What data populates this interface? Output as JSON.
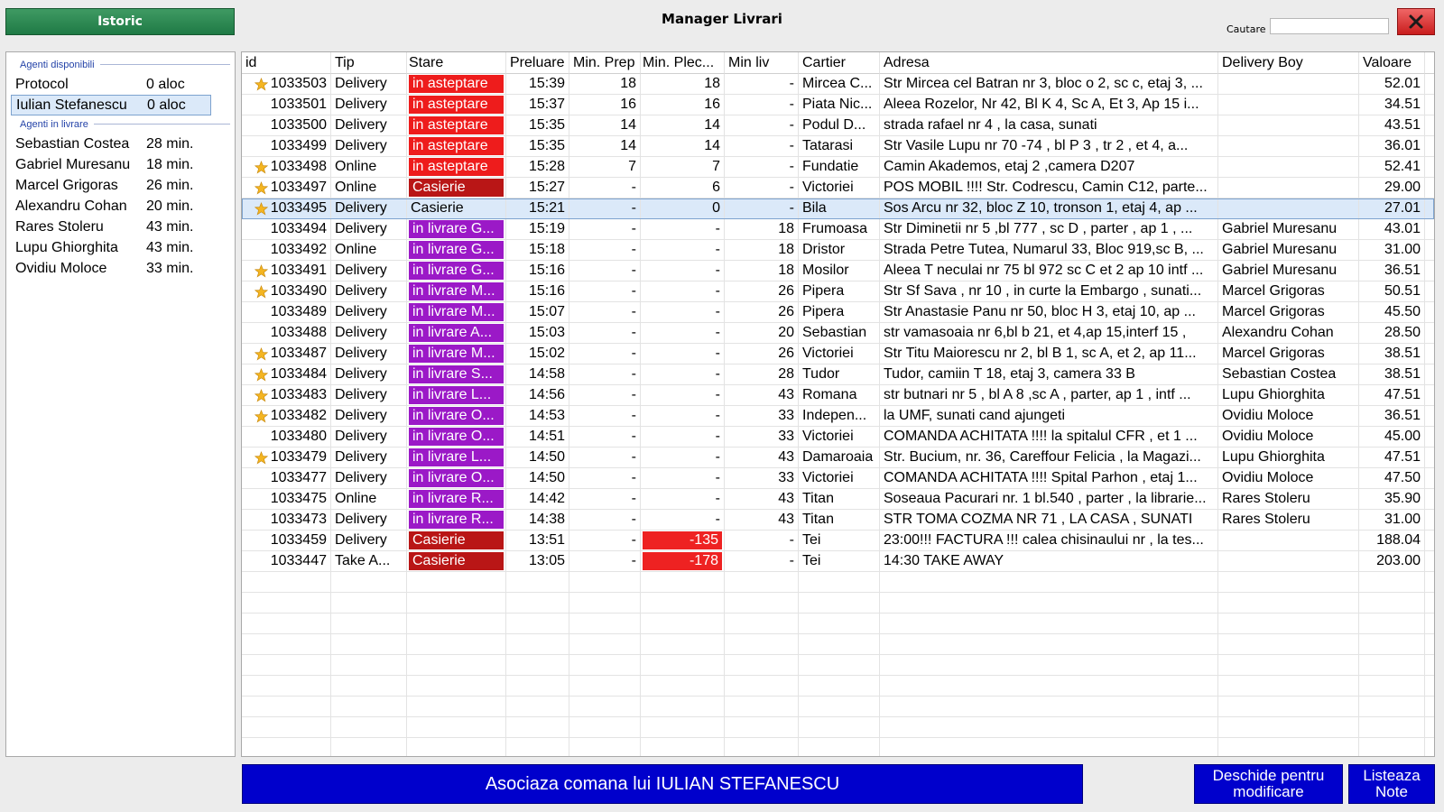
{
  "header": {
    "history_label": "Istoric",
    "title": "Manager Livrari",
    "search_label": "Cautare",
    "search_value": "",
    "close_label": "X"
  },
  "agents": {
    "available_label": "Agenti disponibili",
    "available": [
      {
        "name": "Protocol",
        "status": "0 aloc"
      },
      {
        "name": "Iulian Stefanescu",
        "status": "0 aloc",
        "selected": true
      }
    ],
    "delivering_label": "Agenti in livrare",
    "delivering": [
      {
        "name": "Sebastian Costea",
        "status": "28 min."
      },
      {
        "name": "Gabriel Muresanu",
        "status": "18 min."
      },
      {
        "name": "Marcel Grigoras",
        "status": "26 min."
      },
      {
        "name": "Alexandru Cohan",
        "status": "20 min."
      },
      {
        "name": "Rares Stoleru",
        "status": "43 min."
      },
      {
        "name": "Lupu Ghiorghita",
        "status": "43 min."
      },
      {
        "name": "Ovidiu Moloce",
        "status": "33 min."
      }
    ]
  },
  "colors": {
    "waiting": "#ee1c1c",
    "cashier": "#b91616",
    "delivering": "#9b19c7",
    "negative": "#ee2222",
    "button_blue": "#0000cc"
  },
  "table": {
    "columns": [
      "id",
      "Tip",
      "Stare",
      "Preluare",
      "Min. Prep",
      "Min. Plec...",
      "Min liv",
      "Cartier",
      "Adresa",
      "Delivery Boy",
      "Valoare"
    ],
    "rows": [
      {
        "star": true,
        "id": "1033503",
        "tip": "Delivery",
        "stare": "in asteptare",
        "kind": "waiting",
        "preluare": "15:39",
        "prep": "18",
        "plec": "18",
        "liv": "-",
        "cartier": "Mircea C...",
        "adresa": "Str Mircea cel Batran nr 3, bloc o 2, sc c, etaj 3, ...",
        "boy": "",
        "valoare": "52.01"
      },
      {
        "star": false,
        "id": "1033501",
        "tip": "Delivery",
        "stare": "in asteptare",
        "kind": "waiting",
        "preluare": "15:37",
        "prep": "16",
        "plec": "16",
        "liv": "-",
        "cartier": "Piata Nic...",
        "adresa": "Aleea Rozelor, Nr 42, Bl K 4, Sc A, Et 3, Ap 15 i...",
        "boy": "",
        "valoare": "34.51"
      },
      {
        "star": false,
        "id": "1033500",
        "tip": "Delivery",
        "stare": "in asteptare",
        "kind": "waiting",
        "preluare": "15:35",
        "prep": "14",
        "plec": "14",
        "liv": "-",
        "cartier": "Podul D...",
        "adresa": "strada rafael nr  4 , la casa, sunati",
        "boy": "",
        "valoare": "43.51"
      },
      {
        "star": false,
        "id": "1033499",
        "tip": "Delivery",
        "stare": "in asteptare",
        "kind": "waiting",
        "preluare": "15:35",
        "prep": "14",
        "plec": "14",
        "liv": "-",
        "cartier": "Tatarasi",
        "adresa": " Str Vasile Lupu nr 70 -74 , bl P 3 , tr 2 , et 4, a...",
        "boy": "",
        "valoare": "36.01"
      },
      {
        "star": true,
        "id": "1033498",
        "tip": "Online",
        "stare": "in asteptare",
        "kind": "waiting",
        "preluare": "15:28",
        "prep": "7",
        "plec": "7",
        "liv": "-",
        "cartier": "Fundatie",
        "adresa": "Camin Akademos, etaj 2 ,camera D207",
        "boy": "",
        "valoare": "52.41"
      },
      {
        "star": true,
        "id": "1033497",
        "tip": "Online",
        "stare": "Casierie",
        "kind": "cashier",
        "preluare": "15:27",
        "prep": "-",
        "plec": "6",
        "liv": "-",
        "cartier": "Victoriei",
        "adresa": "POS MOBIL !!!!  Str. Codrescu, Camin C12, parte...",
        "boy": "",
        "valoare": "29.00"
      },
      {
        "star": true,
        "id": "1033495",
        "tip": "Delivery",
        "stare": "Casierie",
        "kind": "plain",
        "selected": true,
        "preluare": "15:21",
        "prep": "-",
        "plec": "0",
        "liv": "-",
        "cartier": "Bila",
        "adresa": "Sos Arcu nr 32, bloc Z 10, tronson  1, etaj 4, ap ...",
        "boy": "",
        "valoare": "27.01"
      },
      {
        "star": false,
        "id": "1033494",
        "tip": "Delivery",
        "stare": "in livrare G...",
        "kind": "delivering",
        "preluare": "15:19",
        "prep": "-",
        "plec": "-",
        "liv": "18",
        "cartier": "Frumoasa",
        "adresa": "Str Diminetii nr 5 ,bl 777 , sc D ,  parter , ap 1 ,  ...",
        "boy": "Gabriel Muresanu",
        "valoare": "43.01"
      },
      {
        "star": false,
        "id": "1033492",
        "tip": "Online",
        "stare": "in livrare G...",
        "kind": "delivering",
        "preluare": "15:18",
        "prep": "-",
        "plec": "-",
        "liv": "18",
        "cartier": "Dristor",
        "adresa": "Strada Petre Tutea, Numarul 33, Bloc 919,sc B,  ...",
        "boy": "Gabriel Muresanu",
        "valoare": "31.00"
      },
      {
        "star": true,
        "id": "1033491",
        "tip": "Delivery",
        "stare": "in livrare G...",
        "kind": "delivering",
        "preluare": "15:16",
        "prep": "-",
        "plec": "-",
        "liv": "18",
        "cartier": "Mosilor",
        "adresa": "Aleea T neculai nr 75 bl 972 sc C et 2 ap 10 intf ...",
        "boy": "Gabriel Muresanu",
        "valoare": "36.51"
      },
      {
        "star": true,
        "id": "1033490",
        "tip": "Delivery",
        "stare": "in livrare M...",
        "kind": "delivering",
        "preluare": "15:16",
        "prep": "-",
        "plec": "-",
        "liv": "26",
        "cartier": "Pipera",
        "adresa": "Str Sf Sava , nr 10 , in curte la Embargo  , sunati...",
        "boy": "Marcel Grigoras",
        "valoare": "50.51"
      },
      {
        "star": false,
        "id": "1033489",
        "tip": "Delivery",
        "stare": "in livrare M...",
        "kind": "delivering",
        "preluare": "15:07",
        "prep": "-",
        "plec": "-",
        "liv": "26",
        "cartier": "Pipera",
        "adresa": "Str Anastasie   Panu nr 50, bloc H 3, etaj 10, ap ...",
        "boy": "Marcel Grigoras",
        "valoare": "45.50"
      },
      {
        "star": false,
        "id": "1033488",
        "tip": "Delivery",
        "stare": "in livrare A...",
        "kind": "delivering",
        "preluare": "15:03",
        "prep": "-",
        "plec": "-",
        "liv": "20",
        "cartier": "Sebastian",
        "adresa": "str vamasoaia nr 6,bl b 21, et 4,ap 15,interf 15 ,",
        "boy": "Alexandru Cohan",
        "valoare": "28.50"
      },
      {
        "star": true,
        "id": "1033487",
        "tip": "Delivery",
        "stare": "in livrare M...",
        "kind": "delivering",
        "preluare": "15:02",
        "prep": "-",
        "plec": "-",
        "liv": "26",
        "cartier": "Victoriei",
        "adresa": "Str Titu  Maiorescu nr 2, bl B 1, sc A, et 2, ap 11...",
        "boy": "Marcel Grigoras",
        "valoare": "38.51"
      },
      {
        "star": true,
        "id": "1033484",
        "tip": "Delivery",
        "stare": "in livrare S...",
        "kind": "delivering",
        "preluare": "14:58",
        "prep": "-",
        "plec": "-",
        "liv": "28",
        "cartier": "Tudor",
        "adresa": "Tudor, camiin T 18, etaj 3, camera 33 B",
        "boy": "Sebastian Costea",
        "valoare": "38.51"
      },
      {
        "star": true,
        "id": "1033483",
        "tip": "Delivery",
        "stare": "in livrare L...",
        "kind": "delivering",
        "preluare": "14:56",
        "prep": "-",
        "plec": "-",
        "liv": "43",
        "cartier": "Romana",
        "adresa": "str butnari nr 5 , bl A 8 ,sc A , parter, ap 1 , intf ...",
        "boy": "Lupu Ghiorghita",
        "valoare": "47.51"
      },
      {
        "star": true,
        "id": "1033482",
        "tip": "Delivery",
        "stare": "in livrare O...",
        "kind": "delivering",
        "preluare": "14:53",
        "prep": "-",
        "plec": "-",
        "liv": "33",
        "cartier": "Indepen...",
        "adresa": "la UMF, sunati cand ajungeti",
        "boy": "Ovidiu Moloce",
        "valoare": "36.51"
      },
      {
        "star": false,
        "id": "1033480",
        "tip": "Delivery",
        "stare": "in livrare O...",
        "kind": "delivering",
        "preluare": "14:51",
        "prep": "-",
        "plec": "-",
        "liv": "33",
        "cartier": "Victoriei",
        "adresa": "COMANDA ACHITATA !!!!  la spitalul CFR , et 1 ...",
        "boy": "Ovidiu Moloce",
        "valoare": "45.00"
      },
      {
        "star": true,
        "id": "1033479",
        "tip": "Delivery",
        "stare": "in livrare L...",
        "kind": "delivering",
        "preluare": "14:50",
        "prep": "-",
        "plec": "-",
        "liv": "43",
        "cartier": "Damaroaia",
        "adresa": "Str. Bucium, nr. 36, Careffour Felicia , la Magazi...",
        "boy": "Lupu Ghiorghita",
        "valoare": "47.51"
      },
      {
        "star": false,
        "id": "1033477",
        "tip": "Delivery",
        "stare": "in livrare O...",
        "kind": "delivering",
        "preluare": "14:50",
        "prep": "-",
        "plec": "-",
        "liv": "33",
        "cartier": "Victoriei",
        "adresa": "COMANDA ACHITATA !!!!  Spital Parhon , etaj 1...",
        "boy": "Ovidiu Moloce",
        "valoare": "47.50"
      },
      {
        "star": false,
        "id": "1033475",
        "tip": "Online",
        "stare": "in livrare R...",
        "kind": "delivering",
        "preluare": "14:42",
        "prep": "-",
        "plec": "-",
        "liv": "43",
        "cartier": "Titan",
        "adresa": "Soseaua Pacurari nr. 1 bl.540 , parter , la librarie...",
        "boy": "Rares Stoleru",
        "valoare": "35.90"
      },
      {
        "star": false,
        "id": "1033473",
        "tip": "Delivery",
        "stare": "in livrare R...",
        "kind": "delivering",
        "preluare": "14:38",
        "prep": "-",
        "plec": "-",
        "liv": "43",
        "cartier": "Titan",
        "adresa": "STR TOMA COZMA NR 71 , LA CASA , SUNATI",
        "boy": "Rares Stoleru",
        "valoare": "31.00"
      },
      {
        "star": false,
        "id": "1033459",
        "tip": "Delivery",
        "stare": "Casierie",
        "kind": "cashier",
        "preluare": "13:51",
        "prep": "-",
        "plec": "-135",
        "plec_negative": true,
        "liv": "-",
        "cartier": "Tei",
        "adresa": "23:00!!! FACTURA !!! calea chisinaului nr  , la tes...",
        "boy": "",
        "valoare": "188.04"
      },
      {
        "star": false,
        "id": "1033447",
        "tip": "Take A...",
        "stare": "Casierie",
        "kind": "cashier",
        "preluare": "13:05",
        "prep": "-",
        "plec": "-178",
        "plec_negative": true,
        "liv": "-",
        "cartier": "Tei",
        "adresa": "14:30  TAKE  AWAY",
        "boy": "",
        "valoare": "203.00"
      }
    ]
  },
  "footer": {
    "assign_label": "Asociaza comana lui IULIAN STEFANESCU",
    "edit_label": "Deschide pentru modificare",
    "notes_label": "Listeaza Note"
  }
}
